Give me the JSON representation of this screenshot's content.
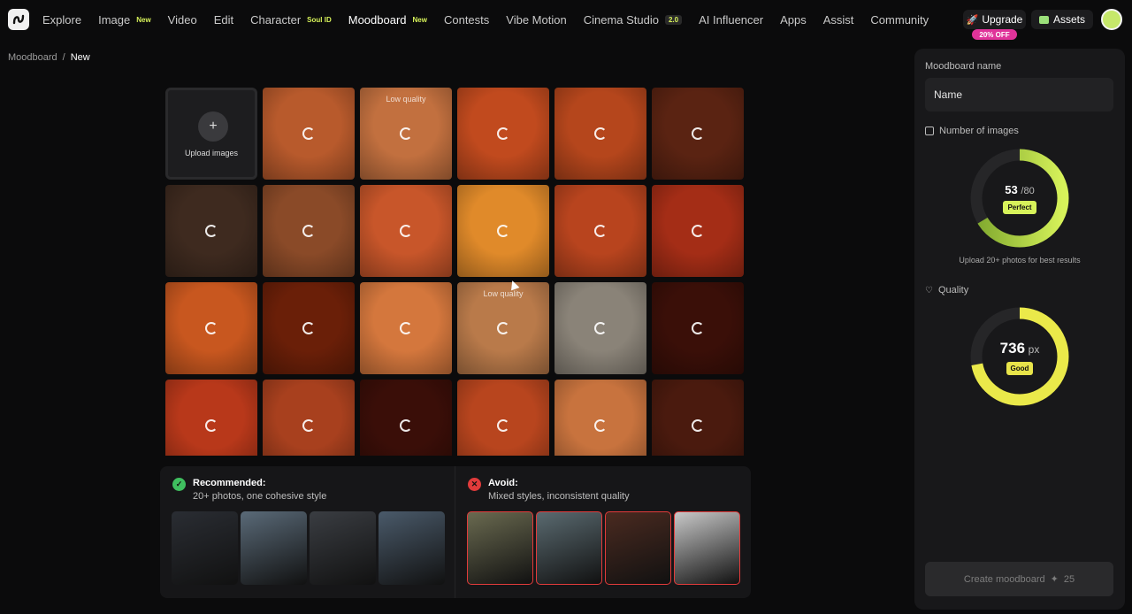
{
  "nav": {
    "items": [
      {
        "label": "Explore",
        "badge": ""
      },
      {
        "label": "Image",
        "badge": "New"
      },
      {
        "label": "Video",
        "badge": ""
      },
      {
        "label": "Edit",
        "badge": ""
      },
      {
        "label": "Character",
        "badge": "Soul ID"
      },
      {
        "label": "Moodboard",
        "badge": "New"
      },
      {
        "label": "Contests",
        "badge": ""
      },
      {
        "label": "Vibe Motion",
        "badge": ""
      },
      {
        "label": "Cinema Studio",
        "badge": "2.0"
      },
      {
        "label": "AI Influencer",
        "badge": ""
      },
      {
        "label": "Apps",
        "badge": ""
      },
      {
        "label": "Assist",
        "badge": ""
      },
      {
        "label": "Community",
        "badge": ""
      }
    ],
    "upgrade_label": "Upgrade",
    "upgrade_discount": "20% OFF",
    "assets_label": "Assets"
  },
  "breadcrumb": {
    "root": "Moodboard",
    "sep": "/",
    "current": "New"
  },
  "upload": {
    "label": "Upload images",
    "plus": "+"
  },
  "grid": {
    "low_quality_label": "Low quality",
    "tiles": [
      {
        "color": "#b85a2c",
        "lq": false
      },
      {
        "color": "#c2703f",
        "lq": true
      },
      {
        "color": "#c14a1e",
        "lq": false
      },
      {
        "color": "#b5461c",
        "lq": false
      },
      {
        "color": "#5a2312",
        "lq": false
      },
      {
        "color": "#3e2a1f",
        "lq": false
      },
      {
        "color": "#8a4a28",
        "lq": false
      },
      {
        "color": "#c8562a",
        "lq": false
      },
      {
        "color": "#e08a2a",
        "lq": false
      },
      {
        "color": "#b8441e",
        "lq": false
      },
      {
        "color": "#a42d16",
        "lq": false
      },
      {
        "color": "#c8571f",
        "lq": false
      },
      {
        "color": "#6a1f08",
        "lq": false
      },
      {
        "color": "#d4773d",
        "lq": false
      },
      {
        "color": "#b97a4a",
        "lq": true
      },
      {
        "color": "#8a8378",
        "lq": false
      },
      {
        "color": "#3a0f08",
        "lq": false
      },
      {
        "color": "#b8381a",
        "lq": false
      },
      {
        "color": "#a8401e",
        "lq": false
      },
      {
        "color": "#3a0e08",
        "lq": false
      },
      {
        "color": "#b8451e",
        "lq": false
      },
      {
        "color": "#c8733e",
        "lq": false
      },
      {
        "color": "#4a1a0e",
        "lq": false
      }
    ]
  },
  "tips": {
    "recommended": {
      "title": "Recommended:",
      "subtitle": "20+ photos, one cohesive style",
      "icon": "check-icon",
      "color": "#3fbf5f",
      "thumbs": [
        "#2a2d33",
        "#5a6a78",
        "#3a3d42",
        "#4a5a6a"
      ]
    },
    "avoid": {
      "title": "Avoid:",
      "subtitle": "Mixed styles, inconsistent quality",
      "icon": "x-icon",
      "color": "#e23b3b",
      "thumbs": [
        "#6a6a50",
        "#5a6a70",
        "#4a2a20",
        "#c8c8c8"
      ]
    }
  },
  "panel": {
    "name_label": "Moodboard name",
    "name_placeholder": "Name",
    "count_label": "Number of images",
    "count_value": "53",
    "count_max": "/80",
    "count_fraction": 0.6625,
    "count_status": "Perfect",
    "count_hint": "Upload 20+ photos for best results",
    "quality_label": "Quality",
    "quality_value": "736",
    "quality_unit": "px",
    "quality_fraction": 0.72,
    "quality_status": "Good",
    "create_label": "Create moodboard",
    "create_cost": "25"
  }
}
